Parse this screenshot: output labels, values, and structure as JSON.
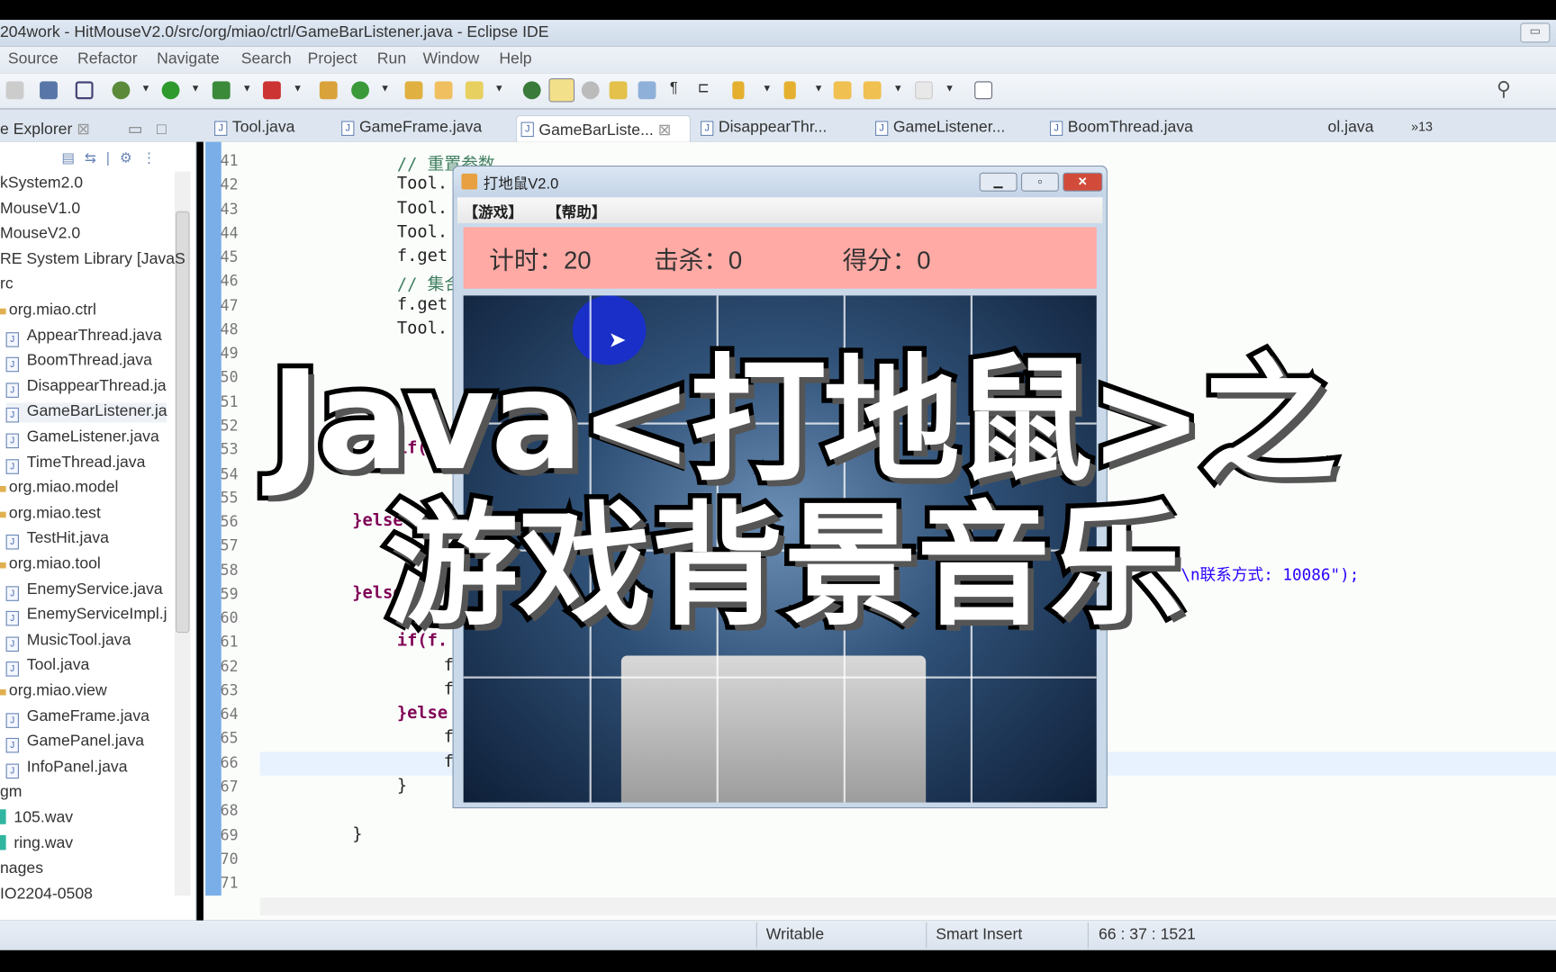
{
  "window": {
    "title": "204work - HitMouseV2.0/src/org/miao/ctrl/GameBarListener.java - Eclipse IDE"
  },
  "menu": [
    "Source",
    "Refactor",
    "Navigate",
    "Search",
    "Project",
    "Run",
    "Window",
    "Help"
  ],
  "tabs": [
    {
      "label": "Tool.java"
    },
    {
      "label": "GameFrame.java"
    },
    {
      "label": "GameBarListe...",
      "active": true
    },
    {
      "label": "DisappearThr..."
    },
    {
      "label": "GameListener..."
    },
    {
      "label": "BoomThread.java"
    },
    {
      "label": "ol.java"
    }
  ],
  "tabs_overflow": "»13",
  "explorer": {
    "title": "e Explorer",
    "items": [
      "kSystem2.0",
      "MouseV1.0",
      "MouseV2.0",
      "RE System Library [JavaS",
      "rc",
      "org.miao.ctrl",
      "AppearThread.java",
      "BoomThread.java",
      "DisappearThread.ja",
      "GameBarListener.ja",
      "GameListener.java",
      "TimeThread.java",
      "org.miao.model",
      "org.miao.test",
      "TestHit.java",
      "org.miao.tool",
      "EnemyService.java",
      "EnemyServiceImpl.j",
      "MusicTool.java",
      "Tool.java",
      "org.miao.view",
      "GameFrame.java",
      "GamePanel.java",
      "InfoPanel.java",
      "gm",
      "105.wav",
      "ring.wav",
      "nages",
      "IO2204-0508"
    ]
  },
  "editor": {
    "line_numbers": [
      "41",
      "42",
      "43",
      "44",
      "45",
      "46",
      "47",
      "48",
      "49",
      "50",
      "51",
      "52",
      "53",
      "54",
      "55",
      "56",
      "57",
      "58",
      "59",
      "60",
      "61",
      "62",
      "63",
      "64",
      "65",
      "66",
      "67",
      "68",
      "69",
      "70",
      "71"
    ],
    "lines": {
      "41": "// 重置参数",
      "42": "Tool.",
      "43": "Tool.",
      "44": "Tool.",
      "45": "f.get",
      "46": "// 集合",
      "47": "f.get",
      "48": "Tool.",
      "53": "if(ke",
      "56": "}else",
      "59": "}else",
      "61": "if(f.",
      "62": "f",
      "63": "f",
      "64": "}else",
      "65": "f",
      "66": "f",
      "67": "}",
      "69": "}"
    },
    "line58_tail": "\\n联系方式: 10086\");",
    "current_line": "66"
  },
  "status": {
    "writable": "Writable",
    "insert_mode": "Smart Insert",
    "position": "66 : 37 : 1521"
  },
  "game": {
    "title": "打地鼠V2.0",
    "menu": [
      "【游戏】",
      "【帮助】"
    ],
    "timer_label": "计时：20",
    "kills_label": "击杀：0",
    "score_label": "得分：0",
    "colors": {
      "info_panel": "#ffaaa5",
      "mole": "#1a2fc8"
    }
  },
  "overlay": {
    "line1": "Java<打地鼠>之",
    "line2": "游戏背景音乐"
  }
}
